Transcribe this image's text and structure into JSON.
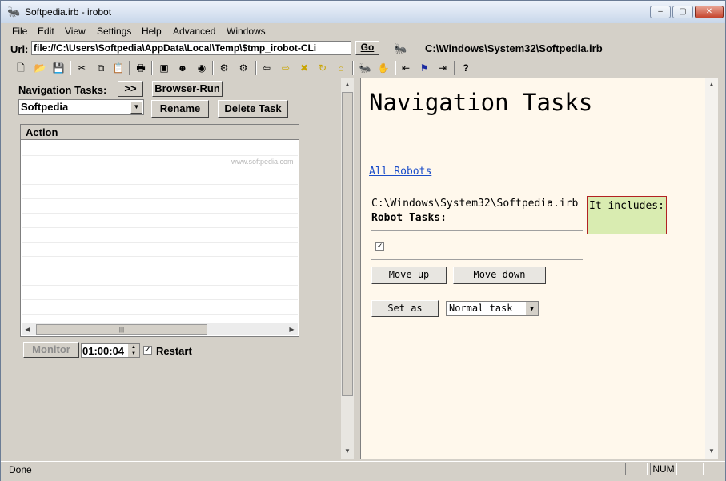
{
  "window": {
    "title": "Softpedia.irb - irobot",
    "minimize": "‒",
    "maximize": "▢",
    "close": "✕"
  },
  "menu": [
    "File",
    "Edit",
    "View",
    "Settings",
    "Help",
    "Advanced",
    "Windows"
  ],
  "urlbar": {
    "label": "Url:",
    "value": "file://C:\\Users\\Softpedia\\AppData\\Local\\Temp\\$tmp_irobot-CLi",
    "go_label": "Go",
    "file_path": "C:\\Windows\\System32\\Softpedia.irb"
  },
  "toolbar": {
    "icons": [
      "new-icon",
      "open-icon",
      "save-icon",
      "cut-icon",
      "copy-icon",
      "paste-icon",
      "print-icon",
      "window-icon",
      "robot-view-icon",
      "robot-eye-icon",
      "run-icon",
      "run-all-icon",
      "back-icon",
      "forward-icon",
      "stop-icon",
      "refresh-icon",
      "home-icon",
      "task-robot-icon",
      "hand-robot-icon",
      "import-icon",
      "flag-icon",
      "export-icon",
      "help-icon"
    ]
  },
  "left": {
    "nav_label": "Navigation Tasks:",
    "expand_btn": ">>",
    "browser_run_btn": "Browser-Run",
    "task_select": "Softpedia",
    "rename_btn": "Rename",
    "delete_btn": "Delete Task",
    "list_header": "Action",
    "monitor_btn": "Monitor",
    "time_value": "01:00:04",
    "restart_label": "Restart",
    "restart_checked": "✓",
    "watermark": "www.softpedia.com"
  },
  "right": {
    "title": "Navigation Tasks",
    "all_robots_link": "All Robots",
    "path": "C:\\Windows\\System32\\Softpedia.irb",
    "robot_tasks_label": "Robot Tasks:",
    "includes_text": "It includes:",
    "task_checked": "✓",
    "move_up_btn": "Move up",
    "move_down_btn": "Move down",
    "set_as_btn": "Set as",
    "task_type_select": "Normal task"
  },
  "status": {
    "text": "Done",
    "num": "NUM"
  }
}
